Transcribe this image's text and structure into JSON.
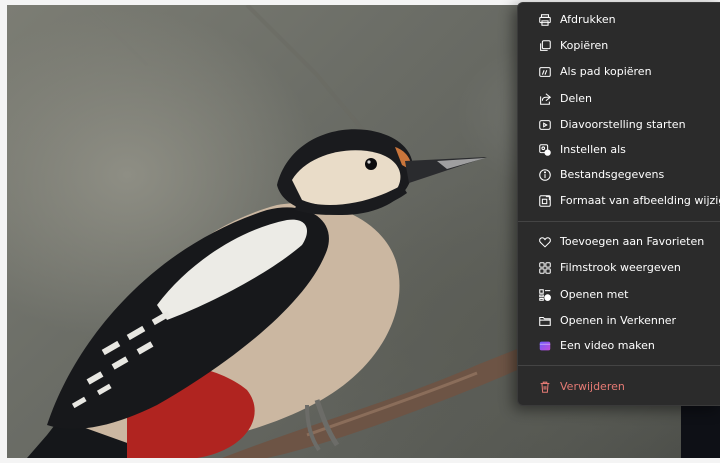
{
  "context_menu": {
    "items": [
      {
        "label": "Afdrukken",
        "icon": "printer-icon"
      },
      {
        "label": "Kopiëren",
        "icon": "copy-icon"
      },
      {
        "label": "Als pad kopiëren",
        "icon": "copy-path-icon"
      },
      {
        "label": "Delen",
        "icon": "share-icon"
      },
      {
        "label": "Diavoorstelling starten",
        "icon": "slideshow-icon"
      },
      {
        "label": "Instellen als",
        "icon": "set-as-icon"
      },
      {
        "label": "Bestandsgegevens",
        "icon": "info-icon"
      },
      {
        "label": "Formaat van afbeelding wijzigen",
        "icon": "resize-icon"
      },
      {
        "label": "Toevoegen aan Favorieten",
        "icon": "heart-icon"
      },
      {
        "label": "Filmstrook weergeven",
        "icon": "filmstrip-icon"
      },
      {
        "label": "Openen met",
        "icon": "open-with-icon"
      },
      {
        "label": "Openen in Verkenner",
        "icon": "folder-icon"
      },
      {
        "label": "Een video maken",
        "icon": "video-editor-icon"
      },
      {
        "label": "Verwijderen",
        "icon": "trash-icon"
      }
    ],
    "colors": {
      "background": "#2b2b2b",
      "text": "#ffffff",
      "danger": "#e57a74",
      "separator": "#444444"
    }
  },
  "photo": {
    "subject": "great-spotted-woodpecker-on-branch"
  }
}
